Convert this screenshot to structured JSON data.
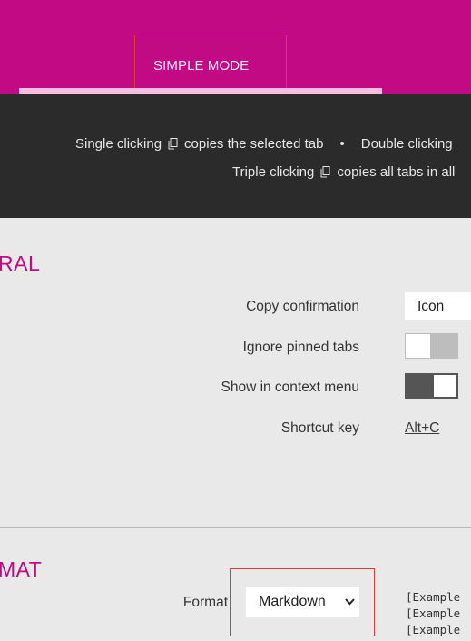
{
  "header": {
    "mode_tab_label": "SIMPLE MODE"
  },
  "info": {
    "line1_a": "Single clicking",
    "line1_b": "copies the selected tab",
    "bullet": "•",
    "line1_c": "Double clicking",
    "line2_a": "Triple clicking",
    "line2_b": "copies all tabs in all",
    "copy_icon": "copy-icon"
  },
  "general": {
    "title": "RAL",
    "copy_confirmation_label": "Copy confirmation",
    "copy_confirmation_value": "Icon",
    "ignore_pinned_label": "Ignore pinned tabs",
    "ignore_pinned_on": false,
    "context_menu_label": "Show in context menu",
    "context_menu_on": true,
    "shortcut_label": "Shortcut key",
    "shortcut_value": "Alt+C"
  },
  "format": {
    "title": "MAT",
    "format_label": "Format",
    "format_value": "Markdown",
    "preview_lines": [
      "[Example",
      "[Example",
      "[Example"
    ]
  },
  "colors": {
    "accent": "#c20a85",
    "dark_band": "#2b2b2b",
    "background": "#e9e9e9",
    "highlight_frame": "#e53935"
  }
}
